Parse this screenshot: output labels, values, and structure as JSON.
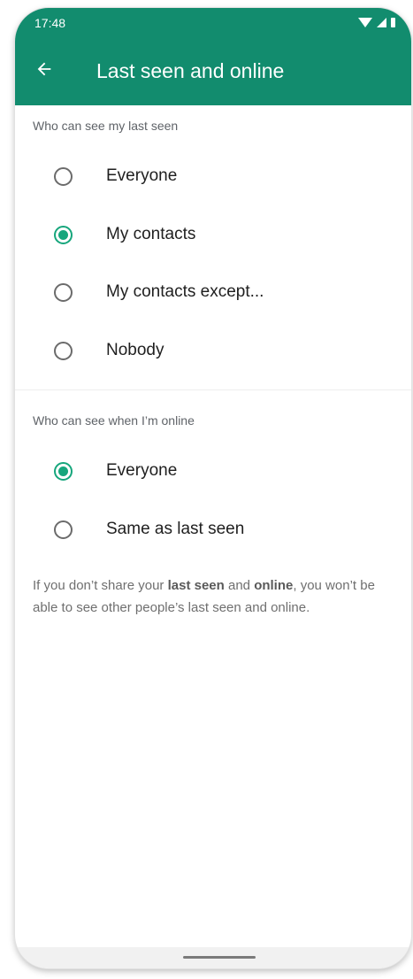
{
  "status_bar": {
    "time": "17:48",
    "icons": [
      "wifi-icon",
      "signal-icon",
      "battery-icon"
    ]
  },
  "app_bar": {
    "title": "Last seen and online",
    "back_icon": "arrow-back-icon",
    "color": "#128c6e"
  },
  "last_seen": {
    "header": "Who can see my last seen",
    "options": [
      {
        "label": "Everyone",
        "selected": false
      },
      {
        "label": "My contacts",
        "selected": true
      },
      {
        "label": "My contacts except...",
        "selected": false
      },
      {
        "label": "Nobody",
        "selected": false
      }
    ]
  },
  "online": {
    "header": "Who can see when I’m online",
    "options": [
      {
        "label": "Everyone",
        "selected": true
      },
      {
        "label": "Same as last seen",
        "selected": false
      }
    ]
  },
  "footnote": {
    "part1": "If you don’t share your ",
    "bold1": "last seen",
    "part2": " and ",
    "bold2": "online",
    "part3": ", you won’t be able to see other people’s last seen and online."
  },
  "colors": {
    "accent": "#16a67c",
    "radio_unchecked": "#6b6b6b"
  }
}
